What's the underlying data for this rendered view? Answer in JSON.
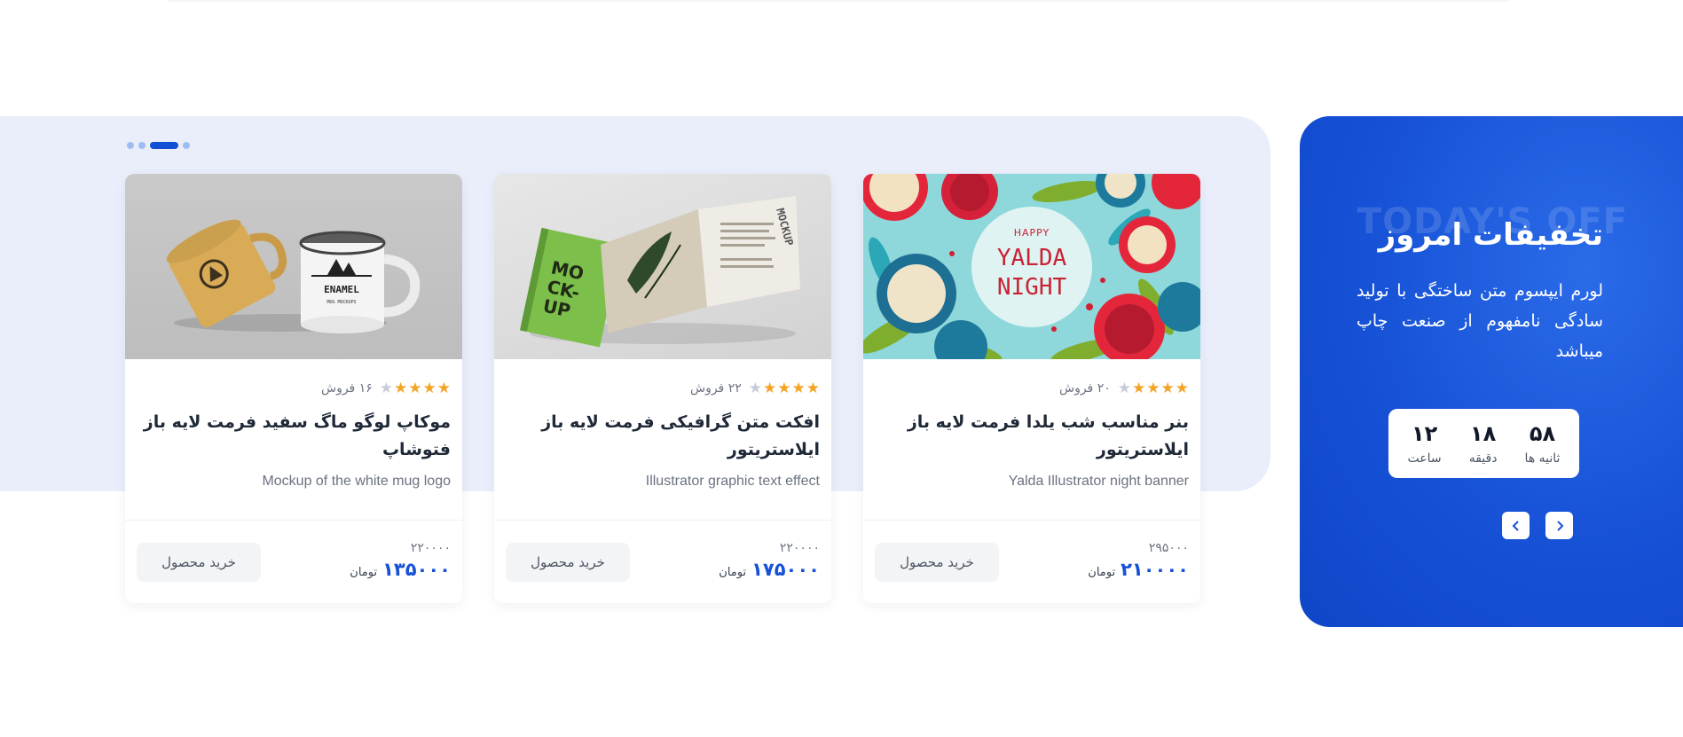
{
  "slider": {
    "dot_count": 4,
    "active_dot": 2
  },
  "offer": {
    "watermark": "TODAY'S OFF",
    "title": "تخفیفات امروز",
    "description": "لورم ایپسوم متن ساختگی با تولید سادگی نامفهوم از صنعت چاپ میباشد",
    "countdown": [
      {
        "value": "۵۸",
        "label": "ثانیه ها"
      },
      {
        "value": "۱۸",
        "label": "دقیقه"
      },
      {
        "value": "۱۲",
        "label": "ساعت"
      }
    ],
    "prev_icon": "chevron-left",
    "next_icon": "chevron-right"
  },
  "products": [
    {
      "title": "بنر مناسب شب یلدا فرمت لایه باز ایلاستریتور",
      "subtitle": "Yalda Illustrator night banner",
      "sales": "۲۰ فروش",
      "rating": 4,
      "old_price": "۲۹۵۰۰۰",
      "price": "۲۱۰۰۰۰",
      "currency": "تومان",
      "buy_label": "خرید محصول",
      "image_text": {
        "line1": "HAPPY",
        "line2": "YALDA",
        "line3": "NIGHT"
      }
    },
    {
      "title": "افکت متن گرافیکی فرمت لایه باز ایلاستریتور",
      "subtitle": "Illustrator graphic text effect",
      "sales": "۲۲ فروش",
      "rating": 4,
      "old_price": "۲۲۰۰۰۰",
      "price": "۱۷۵۰۰۰",
      "currency": "تومان",
      "buy_label": "خرید محصول",
      "image_text": {
        "line1": "MO",
        "line2": "CK-",
        "line3": "UP",
        "spine": "MOCKUP"
      }
    },
    {
      "title": "موکاپ لوگو ماگ سفید فرمت لایه باز فتوشاپ",
      "subtitle": "Mockup of the white mug logo",
      "sales": "۱۶ فروش",
      "rating": 4,
      "old_price": "۲۲۰۰۰۰",
      "price": "۱۳۵۰۰۰",
      "currency": "تومان",
      "buy_label": "خرید محصول",
      "image_text": {
        "line1": "ENAMEL",
        "line2": "MUG MOCKUPS"
      }
    }
  ],
  "colors": {
    "accent": "#1651d6",
    "band": "#e9eefa",
    "star": "#f4a425"
  }
}
